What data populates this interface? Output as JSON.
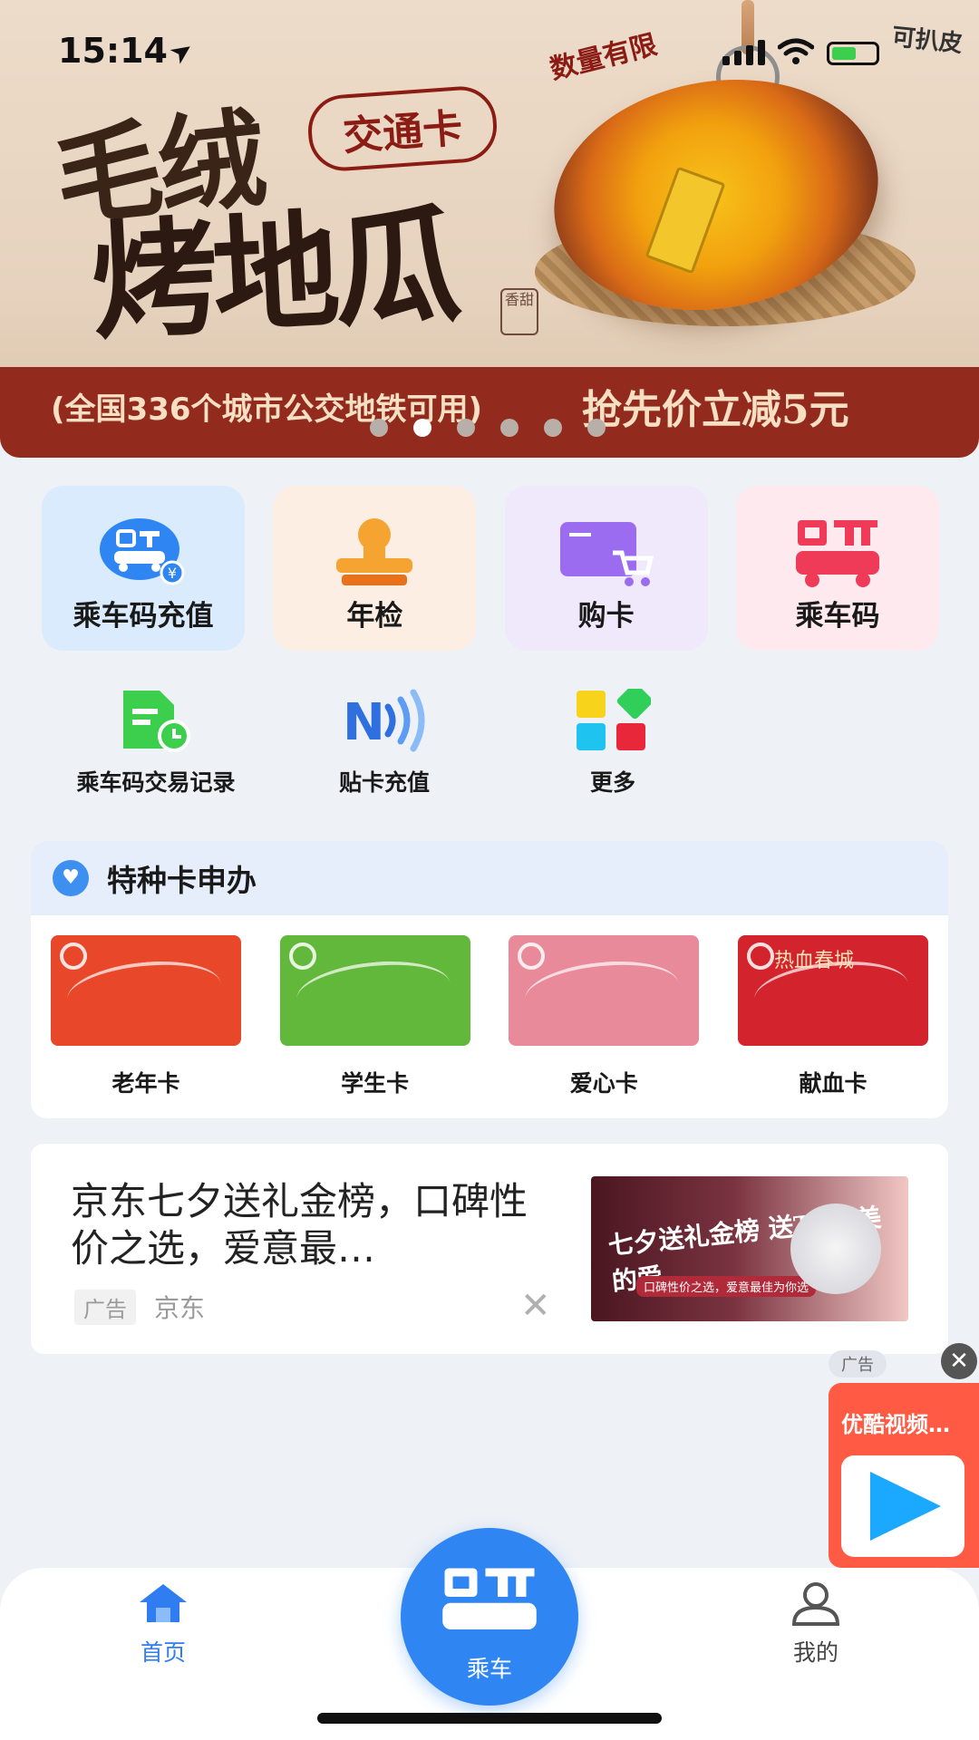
{
  "status": {
    "time": "15:14"
  },
  "banner": {
    "title_line1": "毛绒",
    "title_tag": "交通卡",
    "title_line2": "烤地瓜",
    "seal": "香甜",
    "quantity_text": "数量有限",
    "corner_text": "可扒皮",
    "ribbon_left": "(全国336个城市公交地铁可用)",
    "ribbon_right": "抢先价立减5元",
    "dots_count": 6,
    "active_dot": 1
  },
  "quick_tiles": [
    {
      "label": "乘车码充值",
      "bg": "#d9ebfd"
    },
    {
      "label": "年检",
      "bg": "#fdeee3"
    },
    {
      "label": "购卡",
      "bg": "#efe9fb"
    },
    {
      "label": "乘车码",
      "bg": "#fde9ee"
    }
  ],
  "mini_items": [
    {
      "label": "乘车码交易记录"
    },
    {
      "label": "贴卡充值"
    },
    {
      "label": "更多"
    }
  ],
  "special": {
    "title": "特种卡申办",
    "cards": [
      {
        "label": "老年卡",
        "color": "#e9472a"
      },
      {
        "label": "学生卡",
        "color": "#62b83a"
      },
      {
        "label": "爱心卡",
        "color": "#e98a9a"
      },
      {
        "label": "献血卡",
        "color": "#d3232c",
        "art_text": "热血春城"
      }
    ]
  },
  "ad": {
    "title": "京东七夕送礼金榜，口碑性价之选，爱意最…",
    "badge": "广告",
    "source": "京东",
    "img_text": "七夕送礼金榜 送TA美美的爱",
    "img_subtext": "口碑性价之选，爱意最佳为你选"
  },
  "float_ad": {
    "tag": "广告",
    "title": "优酷视频…"
  },
  "tabbar": {
    "home": "首页",
    "ride": "乘车",
    "me": "我的"
  },
  "colors": {
    "primary": "#2f86f3",
    "banner_ribbon": "#922b1d",
    "page_bg": "#eef1f6"
  }
}
